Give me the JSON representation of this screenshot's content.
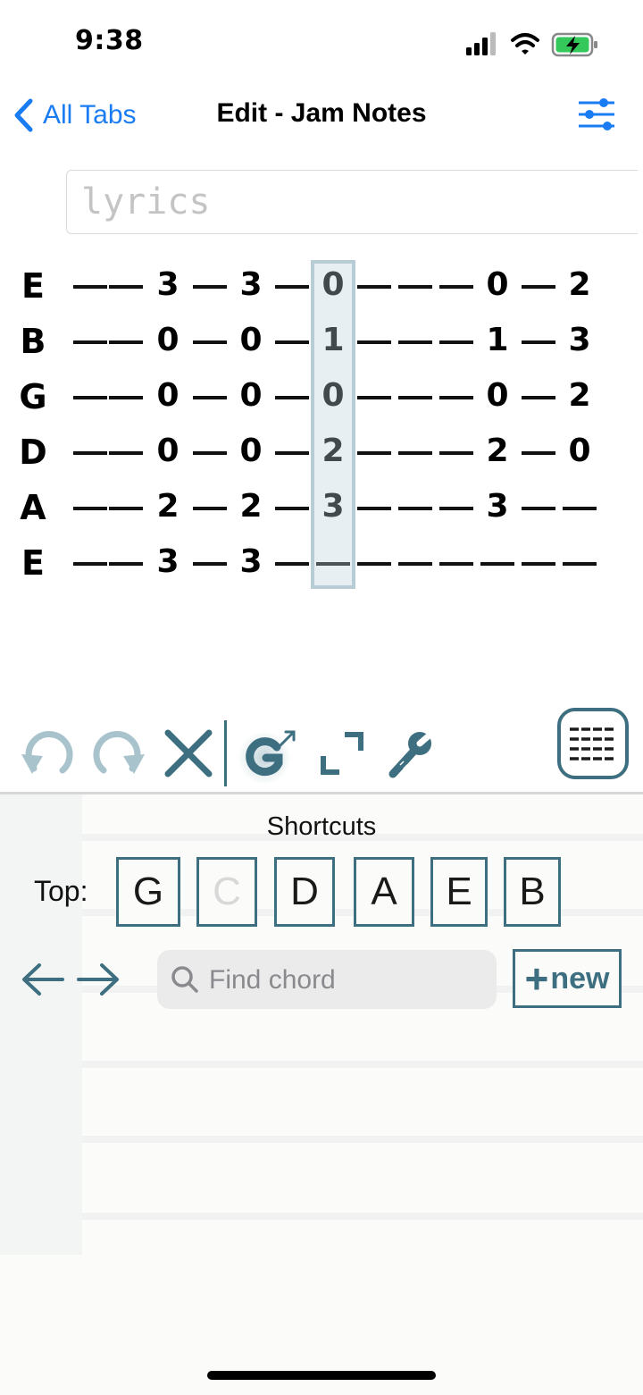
{
  "status_bar": {
    "time": "9:38"
  },
  "nav": {
    "back_label": "All Tabs",
    "title": "Edit - Jam Notes"
  },
  "lyrics": {
    "placeholder": "lyrics",
    "value": ""
  },
  "tab": {
    "selected_column": 6,
    "strings": [
      {
        "name": "E",
        "cells": [
          "-",
          "-",
          "3",
          "-",
          "3",
          "-",
          "0",
          "-",
          "-",
          "-",
          "0",
          "-",
          "2"
        ]
      },
      {
        "name": "B",
        "cells": [
          "-",
          "-",
          "0",
          "-",
          "0",
          "-",
          "1",
          "-",
          "-",
          "-",
          "1",
          "-",
          "3"
        ]
      },
      {
        "name": "G",
        "cells": [
          "-",
          "-",
          "0",
          "-",
          "0",
          "-",
          "0",
          "-",
          "-",
          "-",
          "0",
          "-",
          "2"
        ]
      },
      {
        "name": "D",
        "cells": [
          "-",
          "-",
          "0",
          "-",
          "0",
          "-",
          "2",
          "-",
          "-",
          "-",
          "2",
          "-",
          "0"
        ]
      },
      {
        "name": "A",
        "cells": [
          "-",
          "-",
          "2",
          "-",
          "2",
          "-",
          "3",
          "-",
          "-",
          "-",
          "3",
          "-",
          "-"
        ]
      },
      {
        "name": "E",
        "cells": [
          "-",
          "-",
          "3",
          "-",
          "3",
          "-",
          "-",
          "-",
          "-",
          "-",
          "-",
          "-",
          "-"
        ]
      }
    ]
  },
  "toolbar": {
    "icons": [
      "undo-icon",
      "redo-icon",
      "delete-icon",
      "chord-mode-icon",
      "expand-icon",
      "wrench-icon",
      "keyboard-icon"
    ],
    "accent": "#3d6f80",
    "muted": "#a9c3cd"
  },
  "shortcuts": {
    "title": "Shortcuts",
    "top_label": "Top:",
    "chords": [
      {
        "label": "G",
        "enabled": true
      },
      {
        "label": "C",
        "enabled": false
      },
      {
        "label": "D",
        "enabled": true
      },
      {
        "label": "A",
        "enabled": true
      },
      {
        "label": "E",
        "enabled": true
      },
      {
        "label": "B",
        "enabled": true
      }
    ],
    "search_placeholder": "Find chord",
    "search_value": "",
    "new_plus": "+",
    "new_label": "new"
  },
  "colors": {
    "link_blue": "#1a7cf2",
    "accent": "#3d6f80",
    "selection": "#b7ccd5"
  }
}
